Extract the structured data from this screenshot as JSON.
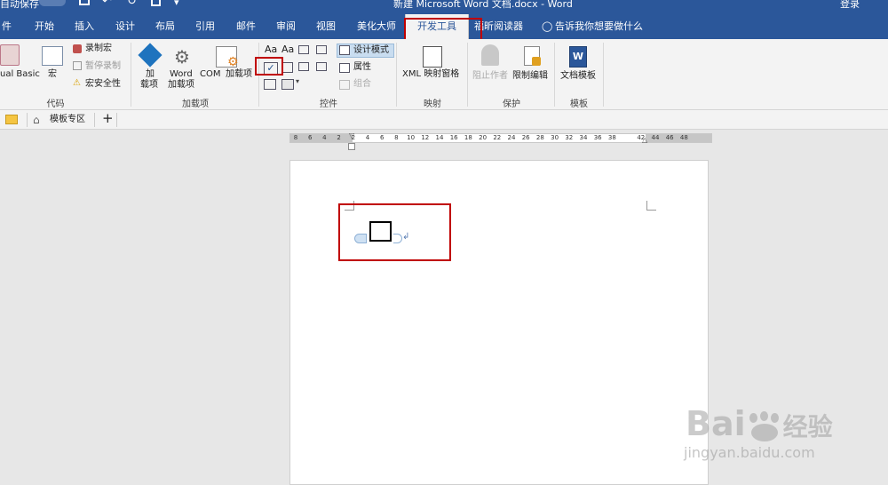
{
  "titlebar": {
    "qa_label": "自动保存",
    "title": "新建 Microsoft Word 文档.docx - Word",
    "login": "登录"
  },
  "tabs": [
    {
      "label": "件"
    },
    {
      "label": "开始"
    },
    {
      "label": "插入"
    },
    {
      "label": "设计"
    },
    {
      "label": "布局"
    },
    {
      "label": "引用"
    },
    {
      "label": "邮件"
    },
    {
      "label": "审阅"
    },
    {
      "label": "视图"
    },
    {
      "label": "美化大师"
    },
    {
      "label": "开发工具",
      "active": true
    },
    {
      "label": "福昕阅读器"
    }
  ],
  "tell_me": "告诉我你想要做什么",
  "ribbon": {
    "code": {
      "visual_basic": "ual Basic",
      "macro": "宏",
      "record": "录制宏",
      "pause": "暂停录制",
      "security": "宏安全性",
      "label": "代码"
    },
    "addins": {
      "addin1": "加",
      "addin2": "载项",
      "word1": "Word",
      "word2": "加载项",
      "com1": "COM",
      "com2": "加载项",
      "label": "加载项"
    },
    "controls": {
      "aa1": "Aa",
      "aa2": "Aa",
      "design_mode": "设计模式",
      "properties": "属性",
      "group": "组合",
      "label": "控件"
    },
    "mapping": {
      "xml": "XML 映射窗格",
      "label": "映射"
    },
    "protect": {
      "block": "阻止作者",
      "restrict": "限制编辑",
      "label": "保护"
    },
    "templates": {
      "doc_template": "文档模板",
      "label": "模板"
    }
  },
  "doc_tabs": {
    "template_zone": "模板专区",
    "add": "+"
  },
  "ruler": [
    "8",
    "6",
    "4",
    "2",
    "2",
    "4",
    "6",
    "8",
    "10",
    "12",
    "14",
    "16",
    "18",
    "20",
    "22",
    "24",
    "26",
    "28",
    "30",
    "32",
    "34",
    "36",
    "38",
    "42",
    "44",
    "46",
    "48"
  ],
  "watermark": {
    "brand": "Bai",
    "brand2": "经验",
    "url": "jingyan.baidu.com"
  },
  "colors": {
    "ribbon_blue": "#2b579a",
    "highlight_red": "#c00000",
    "ribbon_bg": "#f3f3f3"
  }
}
